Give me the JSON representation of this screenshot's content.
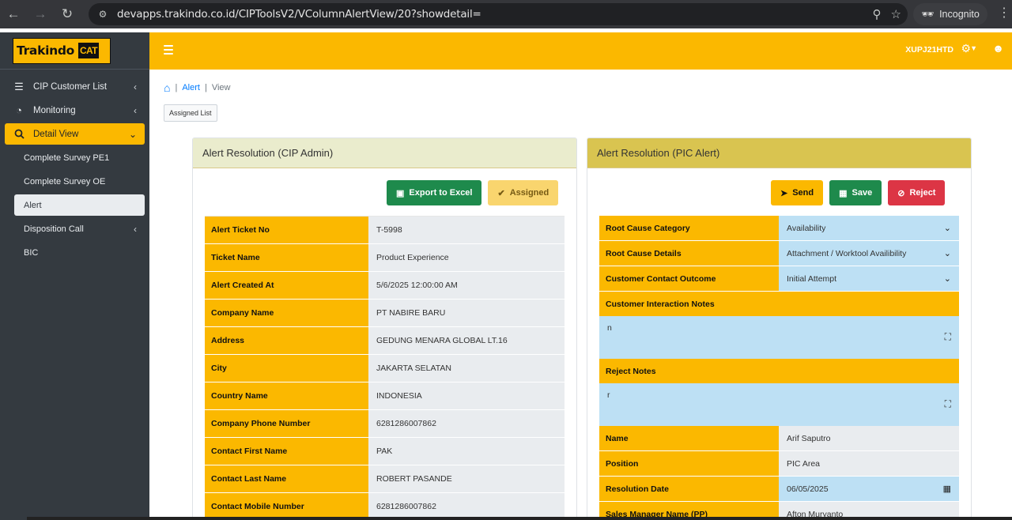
{
  "browser": {
    "url": "devapps.trakindo.co.id/CIPToolsV2/VColumnAlertView/20?showdetail=",
    "incognito_label": "Incognito",
    "back_icon": "arrow-left-icon",
    "forward_icon": "arrow-right-icon",
    "reload_icon": "reload-icon"
  },
  "brand": {
    "name": "Trakindo",
    "mark": "CAT"
  },
  "sidebar": {
    "items": [
      {
        "label": "CIP Customer List",
        "icon": "list-icon"
      },
      {
        "label": "Monitoring",
        "icon": "dashboard-icon"
      },
      {
        "label": "Detail View",
        "icon": "search-icon"
      }
    ],
    "sub_items": [
      {
        "label": "Complete Survey PE1"
      },
      {
        "label": "Complete Survey OE"
      },
      {
        "label": "Alert"
      },
      {
        "label": "Disposition Call"
      },
      {
        "label": "BIC"
      }
    ]
  },
  "topbar": {
    "username": "XUPJ21HTD"
  },
  "breadcrumb": {
    "section": "Alert",
    "current": "View",
    "sep": "|"
  },
  "assigned_list_label": "Assigned List",
  "left_card": {
    "title": "Alert Resolution (CIP Admin)",
    "export_label": "Export to Excel",
    "assigned_label": "Assigned",
    "rows": [
      {
        "label": "Alert Ticket No",
        "value": "T-5998"
      },
      {
        "label": "Ticket Name",
        "value": "Product Experience"
      },
      {
        "label": "Alert Created At",
        "value": "5/6/2025 12:00:00 AM"
      },
      {
        "label": "Company Name",
        "value": "PT NABIRE BARU"
      },
      {
        "label": "Address",
        "value": "GEDUNG MENARA GLOBAL LT.16"
      },
      {
        "label": "City",
        "value": "JAKARTA SELATAN"
      },
      {
        "label": "Country Name",
        "value": "INDONESIA"
      },
      {
        "label": "Company Phone Number",
        "value": "6281286007862"
      },
      {
        "label": "Contact First Name",
        "value": "PAK"
      },
      {
        "label": "Contact Last Name",
        "value": "ROBERT PASANDE"
      },
      {
        "label": "Contact Mobile Number",
        "value": "6281286007862"
      }
    ]
  },
  "right_card": {
    "title": "Alert Resolution (PIC Alert)",
    "send_label": "Send",
    "save_label": "Save",
    "reject_label": "Reject",
    "root_cause_category": {
      "label": "Root Cause Category",
      "value": "Availability"
    },
    "root_cause_details": {
      "label": "Root Cause Details",
      "value": "Attachment / Worktool Availibility"
    },
    "contact_outcome": {
      "label": "Customer Contact Outcome",
      "value": "Initial Attempt"
    },
    "interaction_notes": {
      "label": "Customer Interaction Notes",
      "value": "n"
    },
    "reject_notes": {
      "label": "Reject Notes",
      "value": "r"
    },
    "name": {
      "label": "Name",
      "value": "Arif Saputro"
    },
    "position": {
      "label": "Position",
      "value": "PIC Area"
    },
    "resolution_date": {
      "label": "Resolution Date",
      "value": "06/05/2025"
    },
    "sales_manager": {
      "label": "Sales Manager Name (PP)",
      "value": "Afton Muryanto"
    }
  },
  "colors": {
    "accent": "#fbb800",
    "sidebar": "#343a40",
    "green": "#1e8a4c",
    "red": "#dc3545",
    "field_blue": "#bde0f4"
  }
}
